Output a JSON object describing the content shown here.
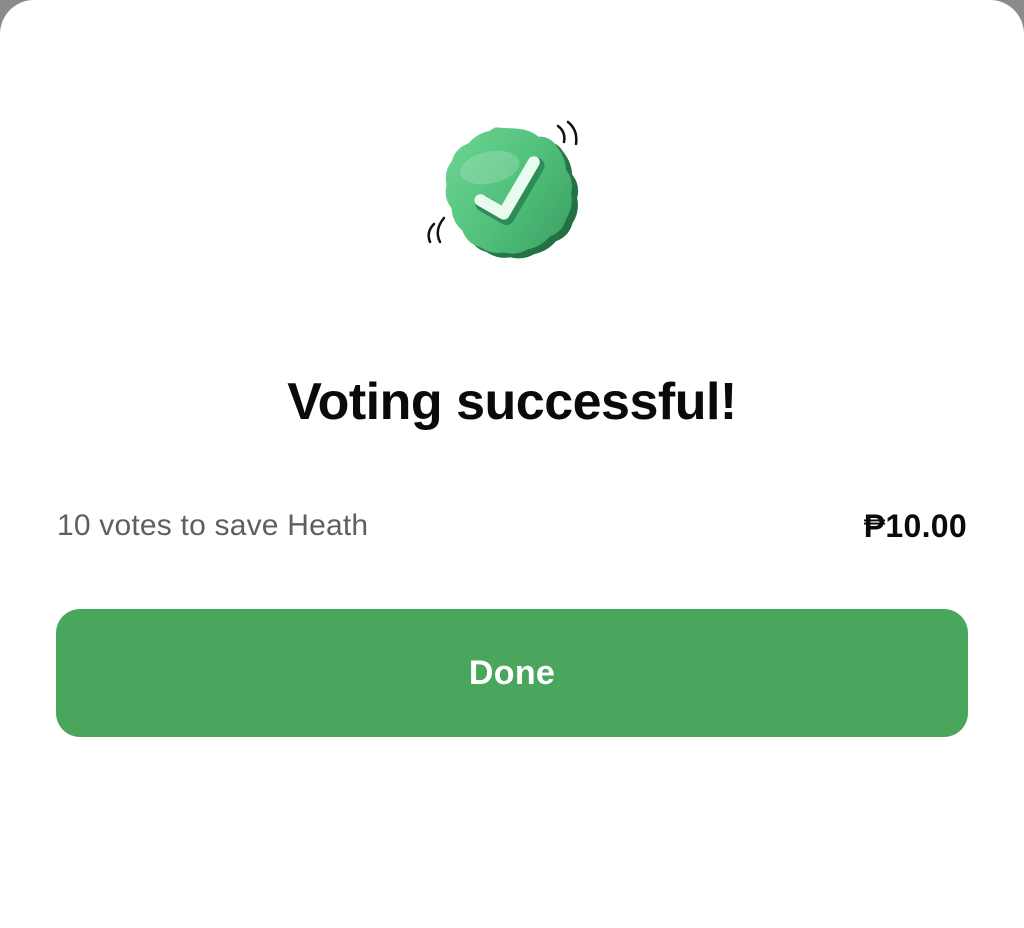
{
  "dialog": {
    "title": "Voting successful!",
    "summary": {
      "description": "10 votes to save Heath",
      "amount": "₱10.00"
    },
    "done_label": "Done"
  },
  "icons": {
    "success": "verified-check-badge-icon"
  },
  "colors": {
    "accent_green": "#4aa65c",
    "badge_green": "#4fbf7a",
    "sheet_background": "#ffffff",
    "title_text": "#0a0a0a",
    "secondary_text": "#5f5f63"
  }
}
